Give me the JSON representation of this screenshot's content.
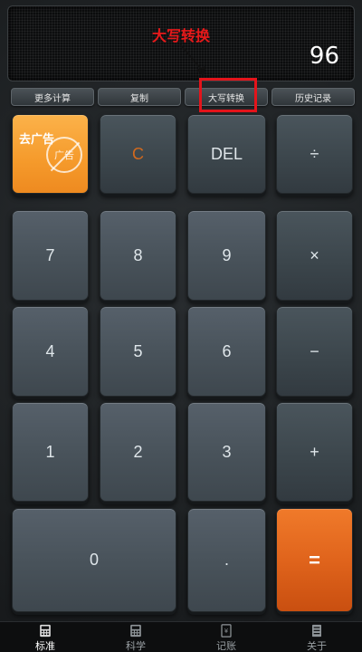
{
  "display": {
    "value": "96"
  },
  "annotation": {
    "label": "大写转换"
  },
  "functions": [
    "更多计算",
    "复制",
    "大写转换",
    "历史记录"
  ],
  "ad": {
    "title": "去广告",
    "stamp": "广告"
  },
  "keys": {
    "c": "C",
    "del": "DEL",
    "divide": "÷",
    "k7": "7",
    "k8": "8",
    "k9": "9",
    "multiply": "×",
    "k4": "4",
    "k5": "5",
    "k6": "6",
    "minus": "−",
    "k1": "1",
    "k2": "2",
    "k3": "3",
    "plus": "+",
    "k0": "0",
    "dot": ".",
    "equals": "="
  },
  "nav": [
    {
      "label": "标准",
      "icon": "calculator-icon"
    },
    {
      "label": "科学",
      "icon": "scientific-calculator-icon"
    },
    {
      "label": "记账",
      "icon": "ledger-icon"
    },
    {
      "label": "关于",
      "icon": "info-icon"
    }
  ],
  "colors": {
    "accent": "#e0641c",
    "annotation": "#e4141b",
    "ad": "#f59a2b"
  }
}
